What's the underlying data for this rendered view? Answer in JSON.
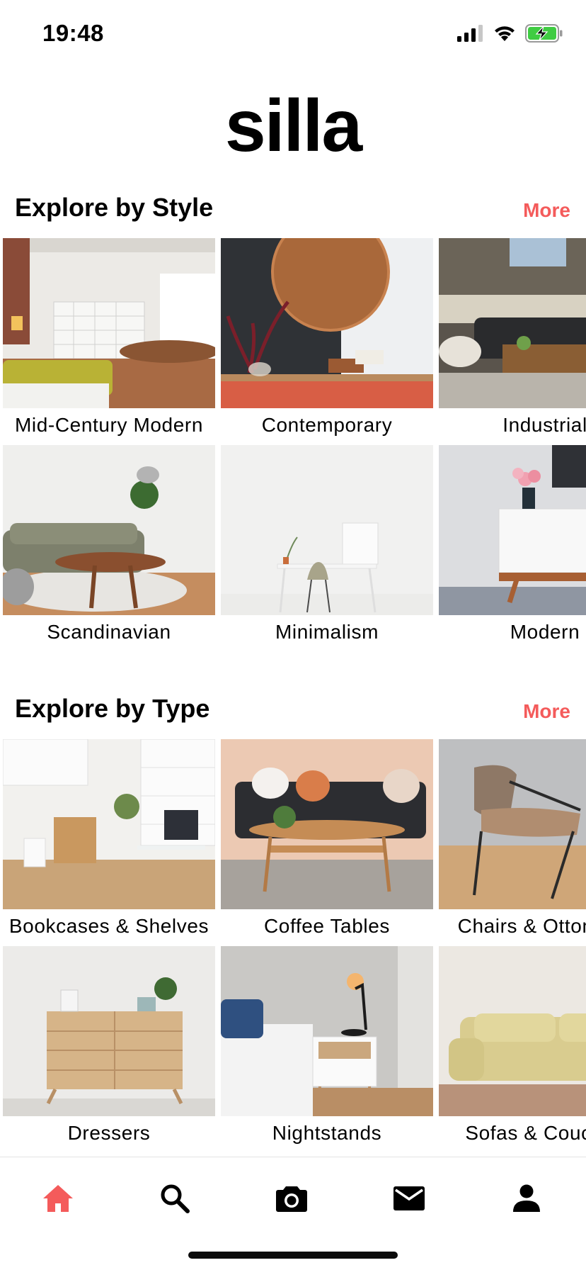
{
  "status_bar": {
    "time": "19:48"
  },
  "app": {
    "title": "silla"
  },
  "colors": {
    "accent": "#f45b5b",
    "text": "#000000"
  },
  "sections": {
    "style": {
      "title": "Explore by Style",
      "more": "More",
      "items": [
        {
          "label": "Mid-Century Modern"
        },
        {
          "label": "Contemporary"
        },
        {
          "label": "Industrial"
        },
        {
          "label": "Scandinavian"
        },
        {
          "label": "Minimalism"
        },
        {
          "label": "Modern"
        }
      ]
    },
    "type": {
      "title": "Explore by Type",
      "more": "More",
      "items": [
        {
          "label": "Bookcases & Shelves"
        },
        {
          "label": "Coffee Tables"
        },
        {
          "label": "Chairs & Ottomans"
        },
        {
          "label": "Dressers"
        },
        {
          "label": "Nightstands"
        },
        {
          "label": "Sofas & Couches"
        }
      ]
    }
  },
  "tab_bar": {
    "items": [
      {
        "icon": "home-icon",
        "active": true
      },
      {
        "icon": "search-icon",
        "active": false
      },
      {
        "icon": "camera-icon",
        "active": false
      },
      {
        "icon": "mail-icon",
        "active": false
      },
      {
        "icon": "profile-icon",
        "active": false
      }
    ]
  }
}
